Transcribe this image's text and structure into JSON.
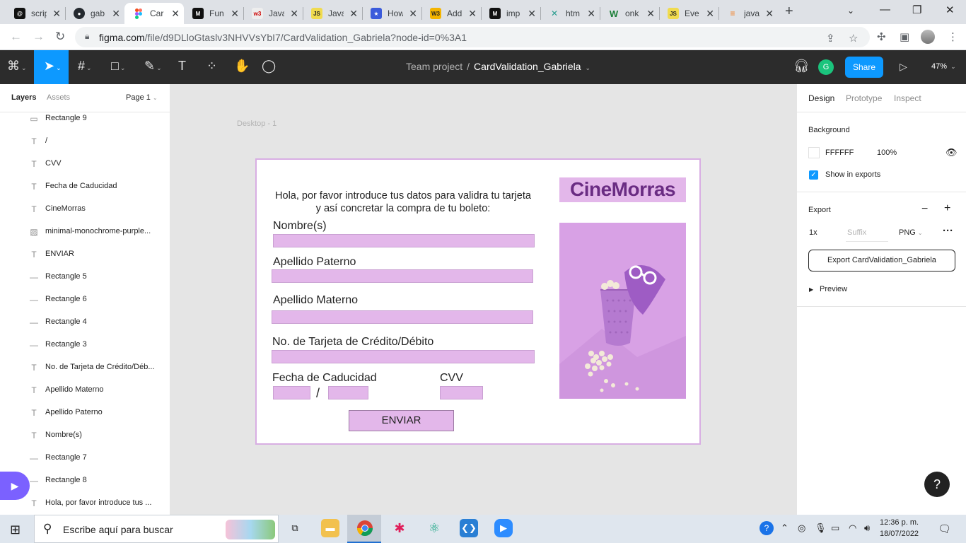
{
  "browser": {
    "tabs": [
      {
        "title": "scrip",
        "icon": "threads-icon",
        "color": "#111111"
      },
      {
        "title": "gab",
        "icon": "github-icon",
        "color": "#24292f"
      },
      {
        "title": "Car",
        "icon": "figma-icon",
        "color": "#f24e1e",
        "active": true
      },
      {
        "title": "Fun",
        "icon": "medium-icon",
        "color": "#111111"
      },
      {
        "title": "Java",
        "icon": "w3r-icon",
        "color": "#e9e9e9"
      },
      {
        "title": "Java",
        "icon": "js-icon",
        "color": "#f0db4f"
      },
      {
        "title": "How",
        "icon": "star-icon",
        "color": "#3b5bdb"
      },
      {
        "title": "Add",
        "icon": "w3schools-icon",
        "color": "#f4b400"
      },
      {
        "title": "imp",
        "icon": "medium-icon",
        "color": "#111111"
      },
      {
        "title": "htm",
        "icon": "arrows-icon",
        "color": "#2a9d8f"
      },
      {
        "title": "onk",
        "icon": "w-icon",
        "color": "#1a7f37"
      },
      {
        "title": "Eve",
        "icon": "js-icon",
        "color": "#f0db4f"
      },
      {
        "title": "java",
        "icon": "stackoverflow-icon",
        "color": "#f48024"
      }
    ],
    "url_host": "figma.com",
    "url_rest": "/file/d9DLloGtaslv3NHVVsYbI7/CardValidation_Gabriela?node-id=0%3A1"
  },
  "figma": {
    "toolbar": {
      "project": "Team project",
      "separator": "/",
      "file_name": "CardValidation_Gabriela",
      "avatar_initial": "G",
      "share_label": "Share",
      "zoom": "47%"
    },
    "left_panel": {
      "tab_layers": "Layers",
      "tab_assets": "Assets",
      "page": "Page 1",
      "layers": [
        {
          "name": "Rectangle 9",
          "icon": "rectangle-icon"
        },
        {
          "name": "/",
          "icon": "text-icon"
        },
        {
          "name": "CVV",
          "icon": "text-icon"
        },
        {
          "name": "Fecha de Caducidad",
          "icon": "text-icon"
        },
        {
          "name": "CineMorras",
          "icon": "text-icon"
        },
        {
          "name": "minimal-monochrome-purple...",
          "icon": "image-icon"
        },
        {
          "name": "ENVIAR",
          "icon": "text-icon"
        },
        {
          "name": "Rectangle 5",
          "icon": "line-icon"
        },
        {
          "name": "Rectangle 6",
          "icon": "line-icon"
        },
        {
          "name": "Rectangle 4",
          "icon": "line-icon"
        },
        {
          "name": "Rectangle 3",
          "icon": "line-icon"
        },
        {
          "name": "No. de Tarjeta de Crédito/Déb...",
          "icon": "text-icon"
        },
        {
          "name": "Apellido Materno",
          "icon": "text-icon"
        },
        {
          "name": "Apellido Paterno",
          "icon": "text-icon"
        },
        {
          "name": "Nombre(s)",
          "icon": "text-icon"
        },
        {
          "name": "Rectangle 7",
          "icon": "line-icon"
        },
        {
          "name": "Rectangle 8",
          "icon": "line-icon"
        },
        {
          "name": "Hola, por favor introduce tus ...",
          "icon": "text-icon"
        }
      ]
    },
    "canvas": {
      "frame_label": "Desktop - 1",
      "intro": "Hola, por favor introduce tus datos para validra tu tarjeta y así concretar la compra de tu boleto:",
      "label_nombre": "Nombre(s)",
      "label_paterno": "Apellido Paterno",
      "label_materno": "Apellido Materno",
      "label_tarjeta": "No. de Tarjeta de Crédito/Débito",
      "label_fecha": "Fecha de Caducidad",
      "label_slash": "/",
      "label_cvv": "CVV",
      "button_enviar": "ENVIAR",
      "logo": "CineMorras",
      "accent": "#e3b7ea",
      "logo_color": "#6a2c83"
    },
    "right_panel": {
      "tab_design": "Design",
      "tab_prototype": "Prototype",
      "tab_inspect": "Inspect",
      "background_title": "Background",
      "bg_hex": "FFFFFF",
      "bg_opacity": "100%",
      "show_in_exports": "Show in exports",
      "export_title": "Export",
      "export_scale": "1x",
      "export_suffix_placeholder": "Suffix",
      "export_format": "PNG",
      "export_button": "Export CardValidation_Gabriela",
      "preview": "Preview",
      "help": "?"
    }
  },
  "taskbar": {
    "search_placeholder": "Escribe aquí para buscar",
    "time": "12:36 p. m.",
    "date": "18/07/2022"
  }
}
